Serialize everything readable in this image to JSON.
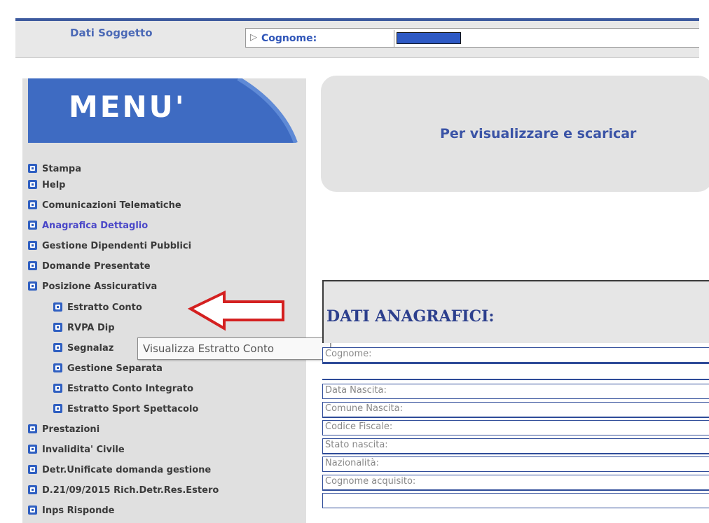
{
  "header": {
    "subject_label": "Dati Soggetto",
    "cognome_label": "Cognome:",
    "cognome_value": ""
  },
  "menu": {
    "title": "MENU'",
    "items": [
      {
        "label": "Stampa",
        "level": 0
      },
      {
        "label": "Help",
        "level": 0
      },
      {
        "label": "Comunicazioni Telematiche",
        "level": 0
      },
      {
        "label": "Anagrafica Dettaglio",
        "level": 0
      },
      {
        "label": "Gestione Dipendenti Pubblici",
        "level": 0
      },
      {
        "label": "Domande Presentate",
        "level": 0
      },
      {
        "label": "Posizione Assicurativa",
        "level": 0
      },
      {
        "label": "Estratto Conto",
        "level": 1
      },
      {
        "label": "RVPA Dip",
        "level": 1
      },
      {
        "label": "Segnalaz",
        "level": 1
      },
      {
        "label": "Gestione Separata",
        "level": 1
      },
      {
        "label": "Estratto Conto Integrato",
        "level": 1
      },
      {
        "label": "Estratto Sport Spettacolo",
        "level": 1
      },
      {
        "label": "Prestazioni",
        "level": 0
      },
      {
        "label": "Invalidita' Civile",
        "level": 0
      },
      {
        "label": "Detr.Unificate domanda gestione",
        "level": 0
      },
      {
        "label": "D.21/09/2015 Rich.Detr.Res.Estero",
        "level": 0
      },
      {
        "label": "Inps Risponde",
        "level": 0
      }
    ]
  },
  "tooltip": "Visualizza Estratto Conto",
  "banner": {
    "text": "Per visualizzare e scaricar"
  },
  "dati_anagrafici": {
    "title": "DATI ANAGRAFICI:",
    "fields": [
      "Cognome:",
      "Data Nascita:",
      "Comune Nascita:",
      "Codice Fiscale:",
      "Stato nascita:",
      "Nazionalità:",
      "Cognome acquisito:"
    ]
  },
  "colors": {
    "menu_header": "#3e6bc2",
    "menu_icon": "#2f5fc1",
    "active_item": "#4b48c8",
    "annotation_arrow": "#d42020",
    "title_blue": "#2c3f8d"
  }
}
